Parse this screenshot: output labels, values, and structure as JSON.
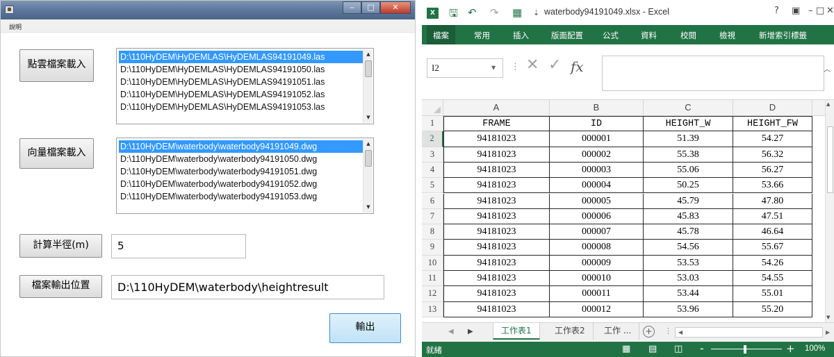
{
  "app": {
    "menu_help": "說明",
    "btn_load_las": "點雲檔案載入",
    "btn_load_dwg": "向量檔案載入",
    "btn_radius": "計算半徑(m)",
    "btn_output_loc": "檔案輸出位置",
    "btn_output": "輸出",
    "las_files": [
      "D:\\110HyDEM\\HyDEMLAS\\HyDEMLAS94191049.las",
      "D:\\110HyDEM\\HyDEMLAS\\HyDEMLAS94191050.las",
      "D:\\110HyDEM\\HyDEMLAS\\HyDEMLAS94191051.las",
      "D:\\110HyDEM\\HyDEMLAS\\HyDEMLAS94191052.las",
      "D:\\110HyDEM\\HyDEMLAS\\HyDEMLAS94191053.las"
    ],
    "dwg_files": [
      "D:\\110HyDEM\\waterbody\\waterbody94191049.dwg",
      "D:\\110HyDEM\\waterbody\\waterbody94191050.dwg",
      "D:\\110HyDEM\\waterbody\\waterbody94191051.dwg",
      "D:\\110HyDEM\\waterbody\\waterbody94191052.dwg",
      "D:\\110HyDEM\\waterbody\\waterbody94191053.dwg"
    ],
    "radius_value": "5",
    "output_path": "D:\\110HyDEM\\waterbody\\heightresult"
  },
  "excel": {
    "title": "waterbody94191049.xlsx - Excel",
    "logo_text": "X",
    "title_help": "?",
    "tabs": [
      "檔案",
      "常用",
      "插入",
      "版面配置",
      "公式",
      "資料",
      "校閱",
      "檢視",
      "新增索引標籤"
    ],
    "name_box": "I2",
    "col_letters": [
      "A",
      "B",
      "C",
      "D"
    ],
    "headers": [
      "FRAME",
      "ID",
      "HEIGHT_W",
      "HEIGHT_FW"
    ],
    "row_numbers": [
      "1",
      "2",
      "3",
      "4",
      "5",
      "6",
      "7",
      "8",
      "9",
      "10",
      "11",
      "12",
      "13"
    ],
    "rows": [
      [
        "94181023",
        "000001",
        "51.39",
        "54.27"
      ],
      [
        "94181023",
        "000002",
        "55.38",
        "56.32"
      ],
      [
        "94181023",
        "000003",
        "55.06",
        "56.27"
      ],
      [
        "94181023",
        "000004",
        "50.25",
        "53.66"
      ],
      [
        "94181023",
        "000005",
        "45.79",
        "47.80"
      ],
      [
        "94181023",
        "000006",
        "45.83",
        "47.51"
      ],
      [
        "94181023",
        "000007",
        "45.78",
        "46.64"
      ],
      [
        "94181023",
        "000008",
        "54.56",
        "55.67"
      ],
      [
        "94181023",
        "000009",
        "53.53",
        "54.26"
      ],
      [
        "94181023",
        "000010",
        "53.03",
        "54.55"
      ],
      [
        "94181023",
        "000011",
        "53.44",
        "55.01"
      ],
      [
        "94181023",
        "000012",
        "53.96",
        "55.20"
      ]
    ],
    "sheets": [
      "工作表1",
      "工作表2",
      "工作 ..."
    ],
    "status_ready": "就緒",
    "zoom": "100%",
    "colors": {
      "accent": "#217346",
      "selection": "#3399ff"
    }
  }
}
